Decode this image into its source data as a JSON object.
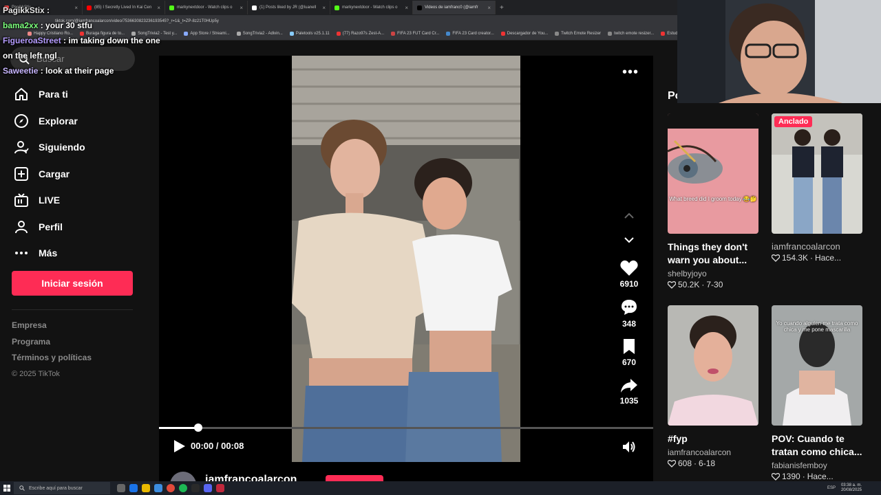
{
  "browser": {
    "tabs": [
      {
        "label": "PagikkStix",
        "color": "#ff4444"
      },
      {
        "label": "(85) I Secretly Lived In Kai Cen",
        "color": "#ff0000"
      },
      {
        "label": "markynextdoor - Watch clips o",
        "color": "#53fc18"
      },
      {
        "label": "(1) Posts liked by JR (@luanell",
        "color": "#ffffff"
      },
      {
        "label": "markynextdoor - Watch clips o",
        "color": "#53fc18"
      },
      {
        "label": "Videos de iamfranc0 (@iamfr",
        "color": "#000000"
      }
    ],
    "new_tab": "+",
    "url": "tiktok.com/@iamfrancoalarcon/video/7536630823236193545?_r=1&_t=ZP-8z21T0HUp5y",
    "bookmarks": [
      "Happy Cristiano Ro...",
      "Buraga figura de to...",
      "SongTrivia2 - Test y...",
      "App Store / Streami...",
      "SongTrivia2 - Adivin...",
      "Paletools v25.1.11",
      "(77) Razo97s Zest-A...",
      "FIFA 23 FUT Card Cr...",
      "FIFA 23 Card creator...",
      "Descargador de You...",
      "Twitch Emote Resizer",
      "twitch emote resizer...",
      "Estudio Prev..."
    ]
  },
  "chat": [
    {
      "user": "PagikkStix",
      "text": ":",
      "style": "u1"
    },
    {
      "user": "bama2xx",
      "text": ": your 30 stfu",
      "style": "u2"
    },
    {
      "user": "FigueroaStreet",
      "text": ": im taking down the one on the left ngl",
      "style": "u3"
    },
    {
      "user": "Saweetie",
      "text": ": look at their page",
      "style": "u4"
    }
  ],
  "sidebar": {
    "search_placeholder": "Buscar",
    "items": [
      {
        "label": "Para ti",
        "icon": "home-icon"
      },
      {
        "label": "Explorar",
        "icon": "compass-icon"
      },
      {
        "label": "Siguiendo",
        "icon": "following-icon"
      },
      {
        "label": "Cargar",
        "icon": "upload-icon"
      },
      {
        "label": "LIVE",
        "icon": "live-icon"
      },
      {
        "label": "Perfil",
        "icon": "profile-icon"
      },
      {
        "label": "Más",
        "icon": "more-icon"
      }
    ],
    "login_label": "Iniciar sesión",
    "footer": [
      "Empresa",
      "Programa",
      "Términos y políticas"
    ],
    "copyright": "© 2025 TikTok"
  },
  "player": {
    "likes": "6910",
    "comments": "348",
    "saves": "670",
    "shares": "1035",
    "time": "00:00 / 00:08",
    "progress": 0.08,
    "author": "iamfrancoalarcon"
  },
  "right": {
    "heading": "Po",
    "cards": [
      {
        "title": "Things they don't warn you about...",
        "author": "shelbyjoyo",
        "likes": "50.2K",
        "date": "7-30",
        "caption": "What breed did I groom today 😂🤔",
        "pinned": ""
      },
      {
        "title": "",
        "author": "iamfrancoalarcon",
        "likes": "154.3K",
        "date": "Hace...",
        "caption": "",
        "pinned": "Anclado"
      },
      {
        "title": "#fyp",
        "author": "iamfrancoalarcon",
        "likes": "608",
        "date": "6-18",
        "caption": "",
        "pinned": ""
      },
      {
        "title": "POV: Cuando te tratan como chica...",
        "author": "fabianisfemboy",
        "likes": "1390",
        "date": "Hace...",
        "caption": "Yo cuando alguien me trata como chica y me pone mascarilla",
        "pinned": ""
      }
    ]
  },
  "taskbar": {
    "search": "Escribe aquí para buscar",
    "tray": "ESP",
    "time": "03:38 a. m.",
    "date": "20/08/2025"
  },
  "colors": {
    "accent": "#fe2c55",
    "background": "#121212"
  }
}
